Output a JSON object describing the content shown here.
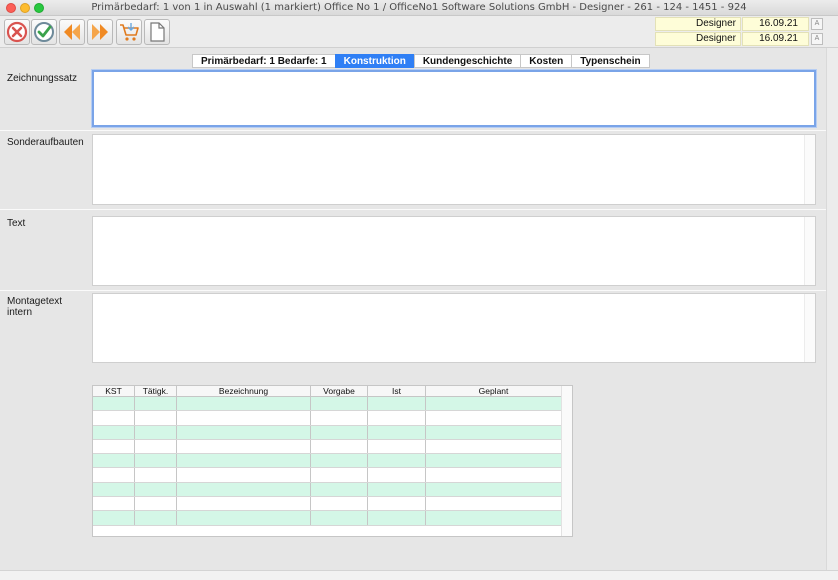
{
  "window": {
    "title": "Primärbedarf: 1 von 1 in Auswahl  (1 markiert) Office No 1 /  OfficeNo1 Software Solutions GmbH - Designer - 261 - 124 - 1451 - 924"
  },
  "toolbar": {
    "buttons": [
      {
        "name": "cancel",
        "icon": "cancel-icon"
      },
      {
        "name": "confirm",
        "icon": "check-icon"
      },
      {
        "name": "previous",
        "icon": "prev-icon"
      },
      {
        "name": "next",
        "icon": "next-icon"
      },
      {
        "name": "cart",
        "icon": "cart-icon"
      },
      {
        "name": "document",
        "icon": "document-icon"
      }
    ]
  },
  "info": {
    "rows": [
      {
        "user": "Designer",
        "date": "16.09.21"
      },
      {
        "user": "Designer",
        "date": "16.09.21"
      }
    ]
  },
  "tabs": [
    {
      "label": "Primärbedarf: 1 Bedarfe: 1",
      "active": false
    },
    {
      "label": "Konstruktion",
      "active": true
    },
    {
      "label": "Kundengeschichte",
      "active": false
    },
    {
      "label": "Kosten",
      "active": false
    },
    {
      "label": "Typenschein",
      "active": false
    }
  ],
  "fields": {
    "zeichnungssatz": {
      "label": "Zeichnungssatz",
      "value": ""
    },
    "sonderaufbauten": {
      "label": "Sonderaufbauten",
      "value": ""
    },
    "text": {
      "label": "Text",
      "value": ""
    },
    "montagetext": {
      "label": "Montagetext intern",
      "value": ""
    }
  },
  "grid": {
    "columns": [
      "KST",
      "Tätigk.",
      "Bezeichnung",
      "Vorgabe",
      "Ist",
      "Geplant"
    ],
    "row_count": 9
  },
  "colors": {
    "accent": "#2f7ff5",
    "row_green": "#d4f7e7",
    "info_bg": "#fefdd8"
  }
}
